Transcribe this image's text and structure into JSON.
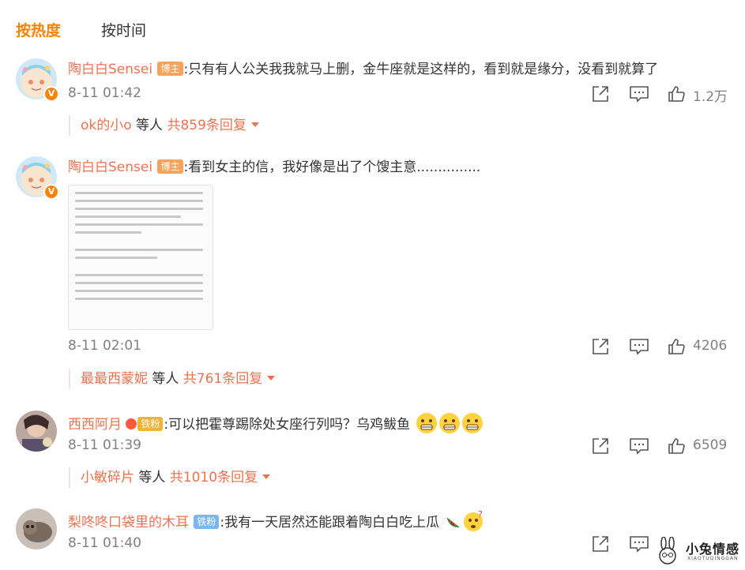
{
  "tabs": {
    "hot": "按热度",
    "time": "按时间"
  },
  "badge_v": "V",
  "comments": [
    {
      "user": "陶白白Sensei",
      "tag": "博主",
      "text": ":只有有人公关我我就马上删，金牛座就是这样的，看到就是缘分，没看到就算了",
      "time": "8-11 01:42",
      "likes": "1.2万",
      "reply_user": "ok的小o",
      "reply_mid": " 等人 ",
      "reply_count": "共859条回复"
    },
    {
      "user": "陶白白Sensei",
      "tag": "博主",
      "text": ":看到女主的信，我好像是出了个馊主意...............",
      "time": "8-11 02:01",
      "likes": "4206",
      "reply_user": "最最西蒙妮",
      "reply_mid": " 等人 ",
      "reply_count": "共761条回复"
    },
    {
      "user": "西西阿月",
      "tag": "铁粉",
      "text": ":可以把霍尊踢除处女座行列吗？乌鸡鲅鱼",
      "time": "8-11 01:39",
      "likes": "6509",
      "reply_user": "小敏碎片",
      "reply_mid": " 等人 ",
      "reply_count": "共1010条回复"
    },
    {
      "user": "梨咚咚口袋里的木耳",
      "tag": "铁粉",
      "text": ":我有一天居然还能跟着陶白白吃上瓜",
      "time": "8-11 01:40",
      "likes": "",
      "reply_user": "",
      "reply_mid": "",
      "reply_count": ""
    }
  ],
  "watermark": {
    "text": "小兔情感",
    "sub": "XIAOTUQINGGAN"
  },
  "colors": {
    "accent": "#ff8200",
    "link": "#eb7350",
    "muted": "#808080"
  },
  "icons": [
    "repost-icon",
    "comment-icon",
    "like-icon",
    "grimace-emoji",
    "watermelon-emoji",
    "thinking-emoji"
  ]
}
